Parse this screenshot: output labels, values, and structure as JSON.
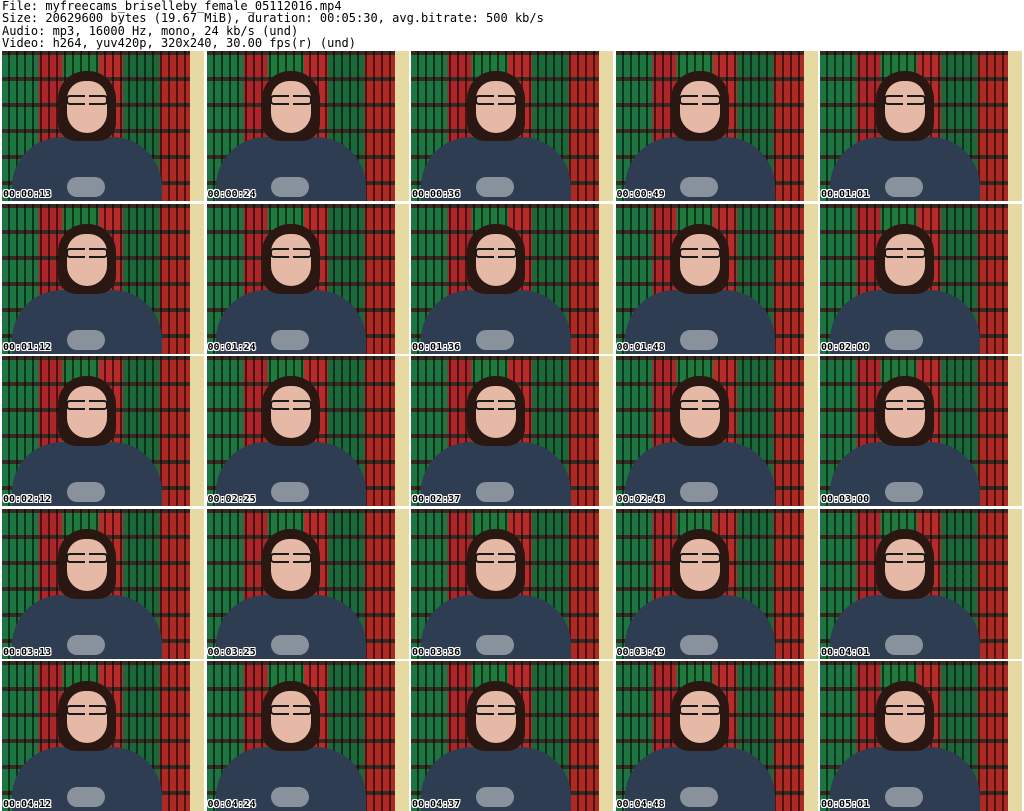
{
  "header": {
    "file": "File: myfreecams_briselleby_female_05112016.mp4",
    "size": "Size: 20629600 bytes (19.67 MiB), duration: 00:05:30, avg.bitrate: 500 kb/s",
    "audio": "Audio: mp3, 16000 Hz, mono, 24 kb/s (und)",
    "video": "Video: h264, yuv420p, 320x240, 30.00 fps(r) (und)"
  },
  "thumbnails": [
    {
      "time": "00:00:13"
    },
    {
      "time": "00:00:24"
    },
    {
      "time": "00:00:36"
    },
    {
      "time": "00:00:49"
    },
    {
      "time": "00:01:01"
    },
    {
      "time": "00:01:12"
    },
    {
      "time": "00:01:24"
    },
    {
      "time": "00:01:36"
    },
    {
      "time": "00:01:48"
    },
    {
      "time": "00:02:00"
    },
    {
      "time": "00:02:12"
    },
    {
      "time": "00:02:25"
    },
    {
      "time": "00:02:37"
    },
    {
      "time": "00:02:48"
    },
    {
      "time": "00:03:00"
    },
    {
      "time": "00:03:13"
    },
    {
      "time": "00:03:25"
    },
    {
      "time": "00:03:36"
    },
    {
      "time": "00:03:49"
    },
    {
      "time": "00:04:01"
    },
    {
      "time": "00:04:12"
    },
    {
      "time": "00:04:24"
    },
    {
      "time": "00:04:37"
    },
    {
      "time": "00:04:48"
    },
    {
      "time": "00:05:01"
    }
  ]
}
